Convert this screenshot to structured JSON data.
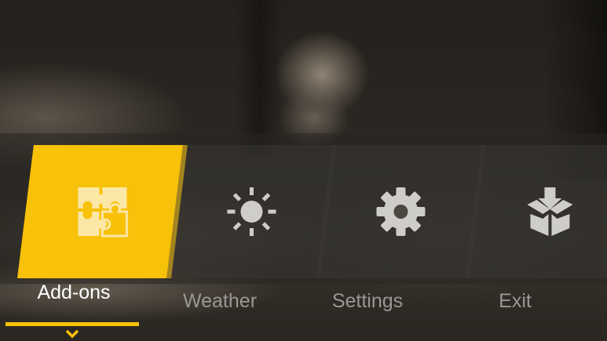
{
  "menu": {
    "items": [
      {
        "label": "Add-ons",
        "icon": "puzzle-icon",
        "active": true
      },
      {
        "label": "Weather",
        "icon": "sun-icon",
        "active": false
      },
      {
        "label": "Settings",
        "icon": "gear-icon",
        "active": false
      },
      {
        "label": "Exit",
        "icon": "download-box-icon",
        "active": false
      }
    ],
    "selected_index": 0
  },
  "colors": {
    "accent": "#f8c10a",
    "label_inactive": "#9a9894",
    "label_active": "#ffffff",
    "icon": "#cfcdca"
  }
}
